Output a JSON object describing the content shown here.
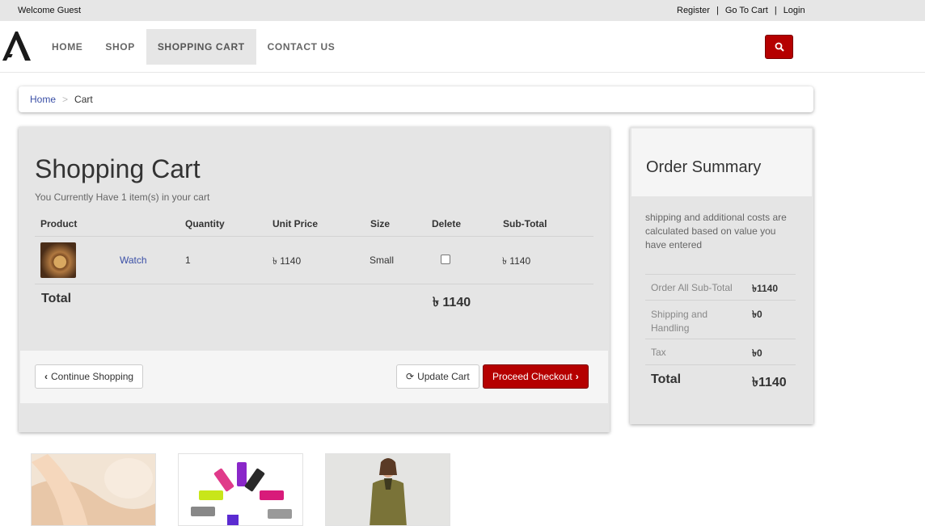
{
  "topbar": {
    "welcome": "Welcome Guest",
    "links": [
      "Register",
      "Go To Cart",
      "Login"
    ],
    "separator": "|"
  },
  "nav": {
    "logo": "logo-icon",
    "items": [
      "HOME",
      "SHOP",
      "SHOPPING CART",
      "CONTACT US"
    ],
    "active": "SHOPPING CART",
    "search_icon": "search-icon",
    "accent": "#b50000"
  },
  "breadcrumb": {
    "home": "Home",
    "separator": ">",
    "current": "Cart"
  },
  "cart": {
    "title": "Shopping Cart",
    "subtitle": "You Currently Have 1 item(s) in your cart",
    "headers": {
      "product": "Product",
      "quantity": "Quantity",
      "unit_price": "Unit Price",
      "size": "Size",
      "delete": "Delete",
      "subtotal": "Sub-Total"
    },
    "items": [
      {
        "name": "Watch",
        "quantity": "1",
        "unit_price": "৳ 1140",
        "size": "Small",
        "delete_checked": false,
        "subtotal": "৳ 1140"
      }
    ],
    "total_label": "Total",
    "total_value": "৳ 1140",
    "buttons": {
      "continue": "Continue Shopping",
      "update": "Update Cart",
      "checkout": "Proceed Checkout"
    }
  },
  "summary": {
    "title": "Order Summary",
    "note": "shipping and additional costs are calculated based on value you have entered",
    "rows": [
      {
        "label": "Order All Sub-Total",
        "value": "৳1140"
      },
      {
        "label": "Shipping and Handling",
        "value": "৳0"
      },
      {
        "label": "Tax",
        "value": "৳0"
      }
    ],
    "total_label": "Total",
    "total_value": "৳1140"
  }
}
